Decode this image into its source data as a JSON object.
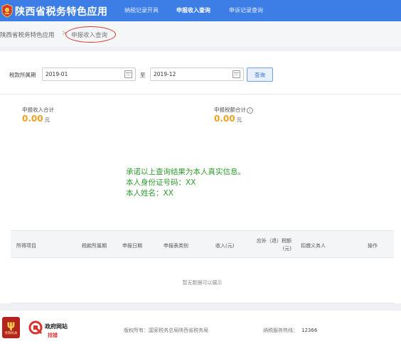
{
  "header": {
    "app_title": "陕西省税务特色应用",
    "nav": [
      {
        "label": "纳税记录开具"
      },
      {
        "label": "申报收入查询"
      },
      {
        "label": "申诉记录查询"
      }
    ]
  },
  "breadcrumb": {
    "root": "陕西省税务特色应用",
    "separator": ">",
    "current": "申报收入查询"
  },
  "filter": {
    "label": "税款所属期",
    "start_date": "2019-01",
    "to_label": "至",
    "end_date": "2019-12",
    "query_label": "查询"
  },
  "summary": {
    "income_label": "申报收入合计",
    "income_value": "0.00",
    "tax_label": "申报税额合计",
    "tax_value": "0.00",
    "unit": "元"
  },
  "notice": {
    "line1": "承诺以上查询结果为本人真实信息。",
    "line2": "本人身份证号码：XX",
    "line3": "本人姓名：XX"
  },
  "table": {
    "columns": [
      "所得项目",
      "税款所属期",
      "申报日期",
      "申报表类别",
      "收入(元)",
      "应补（退）税额(元)",
      "扣缴义务人",
      "操作"
    ],
    "col6_line1": "应补（退）税额",
    "col6_line2": "(元)",
    "empty_text": "暂无数据可以展示"
  },
  "footer": {
    "badge_glyph": "ψ",
    "badge_text": "党政机关",
    "gov_name": "政府网站",
    "gov_sub": "找错",
    "copyright": "版权所有：国家税务总局陕西省税务局",
    "hotline_label": "纳税服务热线：",
    "hotline_number": "12366"
  },
  "colors": {
    "header": "#3d7ee6",
    "accent_orange": "#f0a020",
    "notice_green": "#2e9a2e",
    "annotation_red": "#d9332f"
  }
}
